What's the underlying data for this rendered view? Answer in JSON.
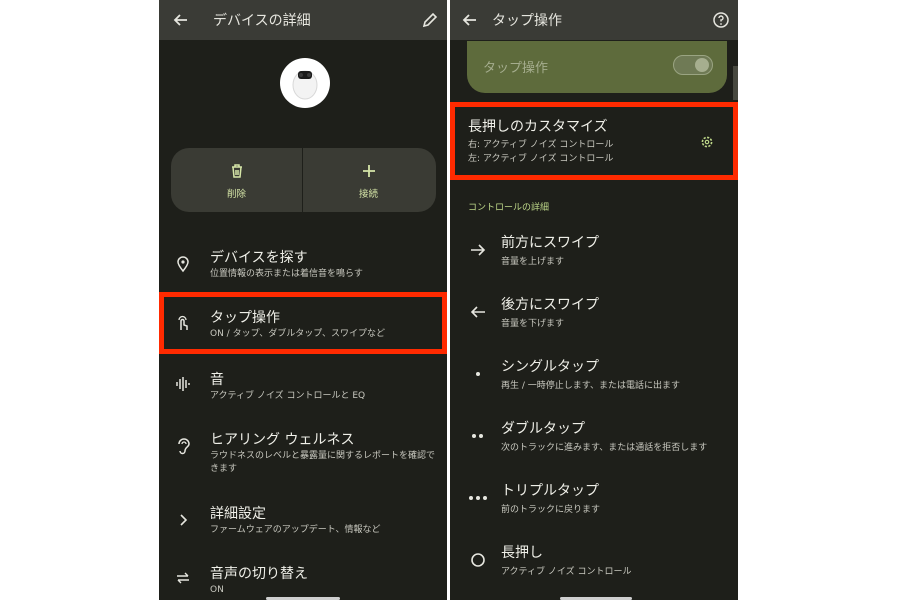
{
  "left": {
    "appbar": {
      "title": "デバイスの詳細",
      "back_icon": "arrow-back-icon",
      "edit_icon": "pencil-icon"
    },
    "actions": [
      {
        "label": "削除",
        "icon": "trash-icon"
      },
      {
        "label": "接続",
        "icon": "plus-icon"
      }
    ],
    "items": [
      {
        "title": "デバイスを探す",
        "subtitle": "位置情報の表示または着信音を鳴らす",
        "icon": "location-pin-icon"
      },
      {
        "title": "タップ操作",
        "subtitle": "ON / タップ、ダブルタップ、スワイプなど",
        "icon": "touch-gesture-icon"
      },
      {
        "title": "音",
        "subtitle": "アクティブ ノイズ コントロールと EQ",
        "icon": "sound-wave-icon"
      },
      {
        "title": "ヒアリング ウェルネス",
        "subtitle": "ラウドネスのレベルと暴露量に関するレポートを確認できます",
        "icon": "ear-icon"
      },
      {
        "title": "詳細設定",
        "subtitle": "ファームウェアのアップデート、情報など",
        "icon": "chevron-right-icon"
      },
      {
        "title": "音声の切り替え",
        "subtitle": "ON",
        "icon": "swap-arrows-icon"
      }
    ]
  },
  "right": {
    "appbar": {
      "title": "タップ操作",
      "back_icon": "arrow-back-icon",
      "help_icon": "help-circle-icon"
    },
    "toggle": {
      "label": "タップ操作",
      "state": "on"
    },
    "long_press": {
      "title": "長押しのカスタマイズ",
      "line1": "右: アクティブ ノイズ コントロール",
      "line2": "左: アクティブ ノイズ コントロール",
      "icon": "gear-icon"
    },
    "section_header": "コントロールの詳細",
    "controls": [
      {
        "title": "前方にスワイプ",
        "subtitle": "音量を上げます",
        "icon": "arrow-right-icon"
      },
      {
        "title": "後方にスワイプ",
        "subtitle": "音量を下げます",
        "icon": "arrow-left-icon"
      },
      {
        "title": "シングルタップ",
        "subtitle": "再生 / 一時停止します、または電話に出ます",
        "icon": "single-dot-icon"
      },
      {
        "title": "ダブルタップ",
        "subtitle": "次のトラックに進みます、または通話を拒否します",
        "icon": "double-dot-icon"
      },
      {
        "title": "トリプルタップ",
        "subtitle": "前のトラックに戻ります",
        "icon": "triple-dot-icon"
      },
      {
        "title": "長押し",
        "subtitle": "アクティブ ノイズ コントロール",
        "icon": "circle-outline-icon"
      }
    ]
  },
  "colors": {
    "background": "#1e1f1a",
    "appbar": "#3a3b36",
    "highlight_box": "#ff2a00",
    "accent": "#d6e6a8",
    "toggle_card": "#5e6b3c"
  }
}
